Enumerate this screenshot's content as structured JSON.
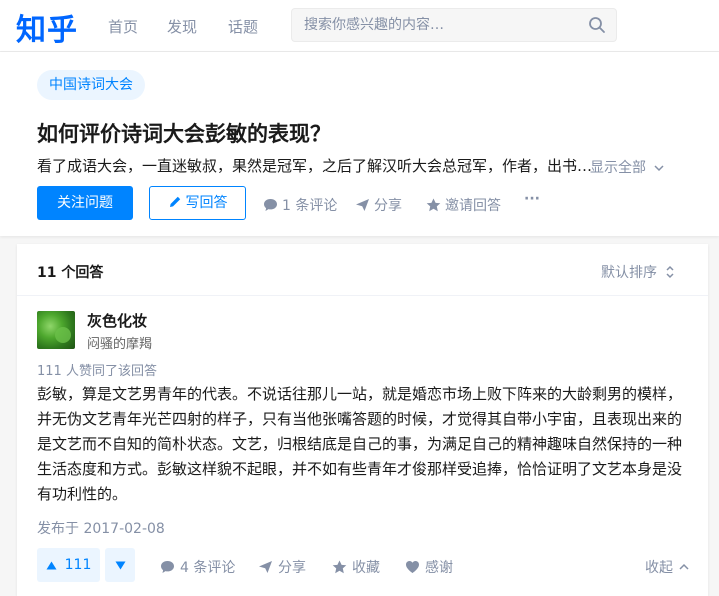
{
  "header": {
    "logo": "知乎",
    "nav": [
      "首页",
      "发现",
      "话题"
    ],
    "search_placeholder": "搜索你感兴趣的内容…"
  },
  "question": {
    "topic_tag": "中国诗词大会",
    "title": "如何评价诗词大会彭敏的表现？",
    "detail": "看了成语大会，一直迷敏叔，果然是冠军，之后了解汉听大会总冠军，作者，出书…",
    "show_all": "显示全部",
    "follow_label": "关注问题",
    "write_label": "写回答",
    "comments_label": "1 条评论",
    "share_label": "分享",
    "invite_label": "邀请回答",
    "more_label": "···"
  },
  "answers": {
    "count_label": "11 个回答",
    "sort_label": "默认排序",
    "items": [
      {
        "author_name": "灰色化妆",
        "author_bio": "闷骚的摩羯",
        "votes_line": "111 人赞同了该回答",
        "content": "彭敏，算是文艺男青年的代表。不说话往那儿一站，就是婚恋市场上败下阵来的大龄剩男的模样，并无伪文艺青年光芒四射的样子，只有当他张嘴答题的时候，才觉得其自带小宇宙，且表现出来的是文艺而不自知的简朴状态。文艺，归根结底是自己的事，为满足自己的精神趣味自然保持的一种生活态度和方式。彭敏这样貌不起眼，并不如有些青年才俊那样受追捧，恰恰证明了文艺本身是没有功利性的。",
        "date": "发布于 2017-02-08",
        "upvote_count": "111",
        "comments_label": "4 条评论",
        "share_label": "分享",
        "collect_label": "收藏",
        "thanks_label": "感谢",
        "collapse_label": "收起"
      }
    ]
  },
  "colors": {
    "brand": "#0066ff",
    "accent": "#0084ff",
    "muted": "#8590a6",
    "tag_bg": "#ebf5ff"
  }
}
